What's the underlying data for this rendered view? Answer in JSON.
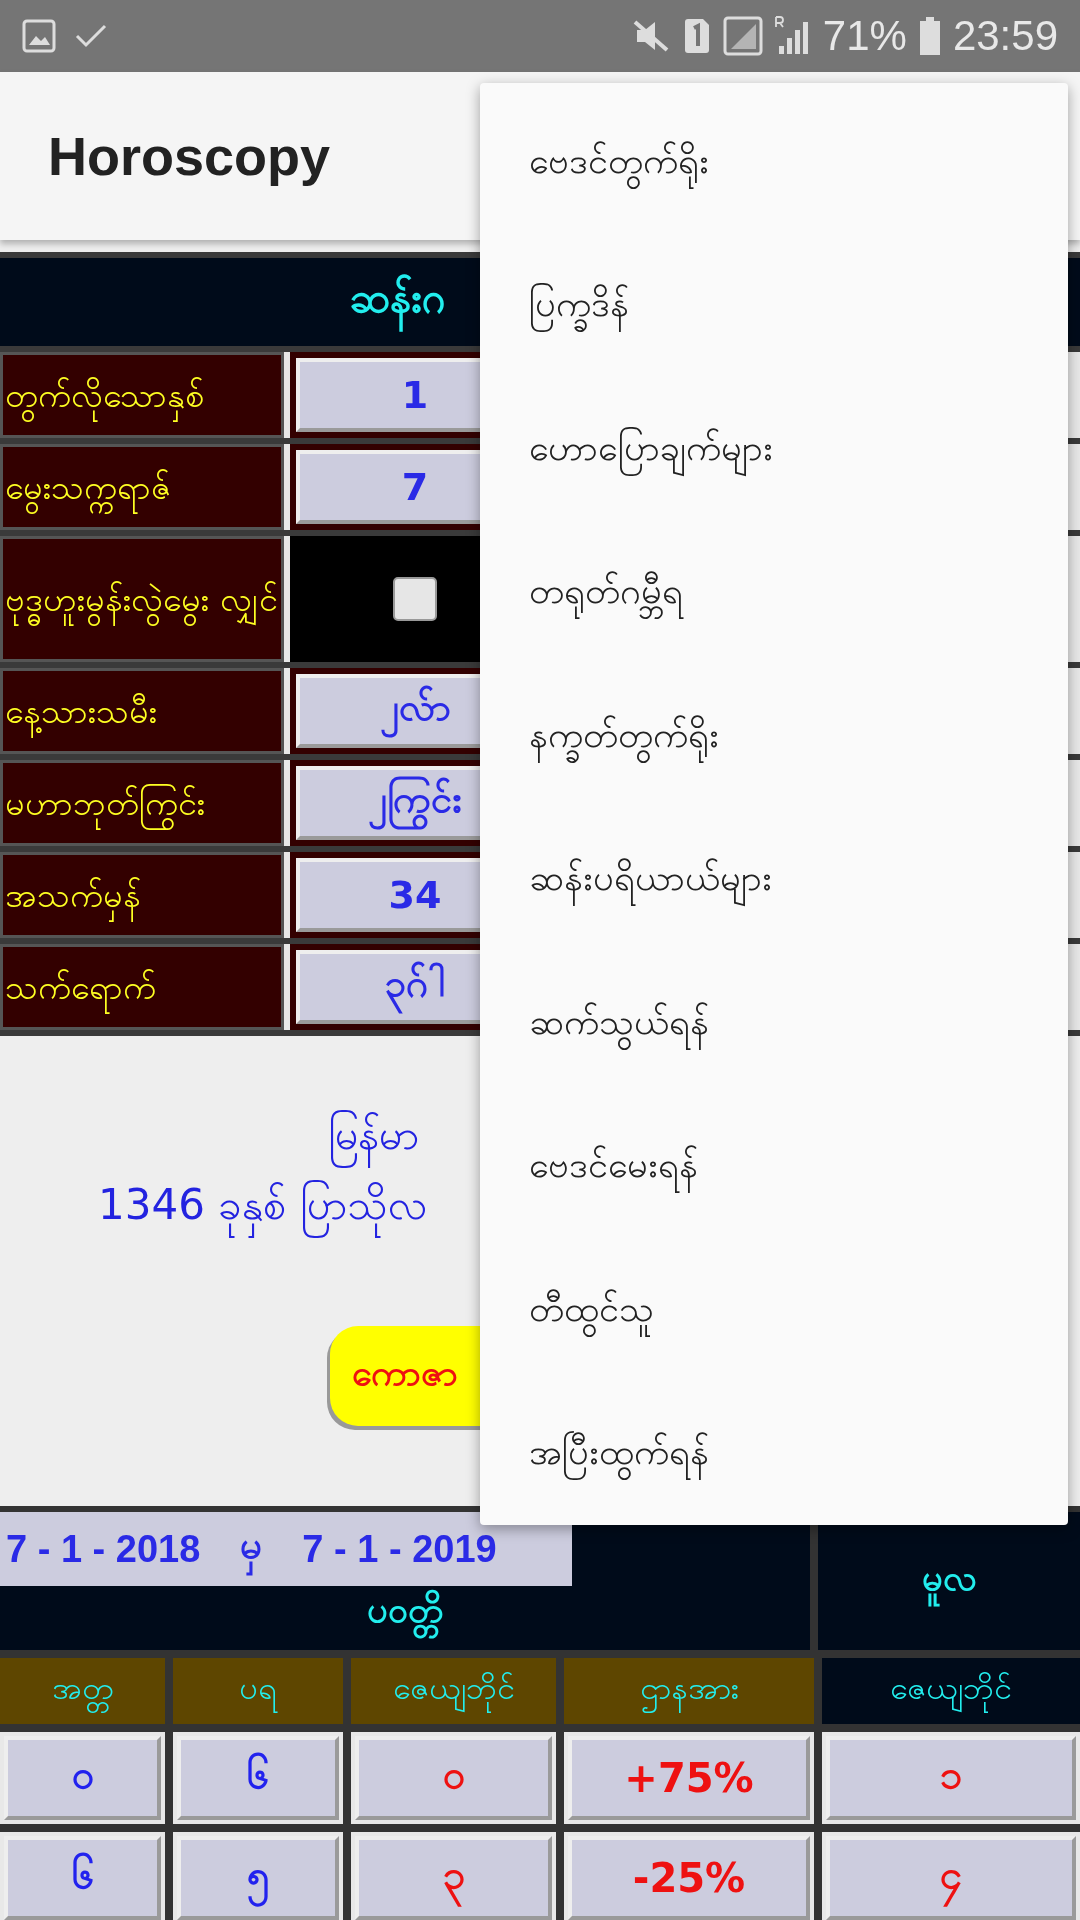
{
  "status_bar": {
    "battery": "71%",
    "time": "23:59"
  },
  "app_bar": {
    "title": "Horoscopy"
  },
  "form": {
    "title": "ဆန်းဂ",
    "rows": [
      {
        "kind": "text",
        "label": "တွက်လိုသောနှစ်",
        "value": "1"
      },
      {
        "kind": "text",
        "label": "မွေးသက္ကရာဇ်",
        "value": "7"
      },
      {
        "kind": "checkbox",
        "label": "ဗုဒ္ဓဟူးမွန်းလွဲမွေး လျှင်",
        "checked": false
      },
      {
        "kind": "text",
        "label": "နေ့သားသမီး",
        "value": "၂လ်ာ"
      },
      {
        "kind": "text",
        "label": "မဟာဘုတ်ကြွင်း",
        "value": "၂ကြွင်း"
      },
      {
        "kind": "text",
        "label": "အသက်မှန်",
        "value": "34"
      },
      {
        "kind": "text",
        "label": "သက်ရောက်",
        "value": "၃ဂ်ါ"
      }
    ]
  },
  "info": {
    "lines": [
      "မြန်မာ",
      "1346 ခုနှစ် ပြာသိုလ"
    ],
    "button": "ကောဇာ"
  },
  "result": {
    "from": "7 - 1 - 2018",
    "joiner": "မှ",
    "to": "7 - 1 - 2019",
    "group_left": "ပဝတ္တိ",
    "group_right": "မူလ",
    "columns": [
      {
        "label": "အတ္တ",
        "kind": "gold"
      },
      {
        "label": "ပရ",
        "kind": "gold"
      },
      {
        "label": "ဇေယျဘိုင်",
        "kind": "gold"
      },
      {
        "label": "ဌာနအား",
        "kind": "gold"
      },
      {
        "label": "ဇေယျဘိုင်",
        "kind": "navy"
      }
    ],
    "rows": [
      {
        "cells": [
          {
            "text": "၀",
            "kind": "blue"
          },
          {
            "text": "၆",
            "kind": "blue"
          },
          {
            "text": "၀",
            "kind": "red"
          },
          {
            "text": "+75%",
            "kind": "red"
          },
          {
            "text": "၁",
            "kind": "red"
          }
        ]
      },
      {
        "cells": [
          {
            "text": "၆",
            "kind": "blue"
          },
          {
            "text": "၅",
            "kind": "blue"
          },
          {
            "text": "၃",
            "kind": "red"
          },
          {
            "text": "-25%",
            "kind": "red"
          },
          {
            "text": "၄",
            "kind": "red"
          }
        ]
      }
    ]
  },
  "menu": {
    "items": [
      "ဗေဒင်တွက်ရိုး",
      "ပြက္ခဒိန်",
      "ဟောပြောချက်များ",
      "တရုတ်ဂမ္ဘီရ",
      "နက္ခတ်တွက်ရိုး",
      "ဆန်းပရိယာယ်များ",
      "ဆက်သွယ်ရန်",
      "ဗေဒင်မေးရန်",
      "တီထွင်သူ",
      "အပြီးထွက်ရန်"
    ]
  }
}
